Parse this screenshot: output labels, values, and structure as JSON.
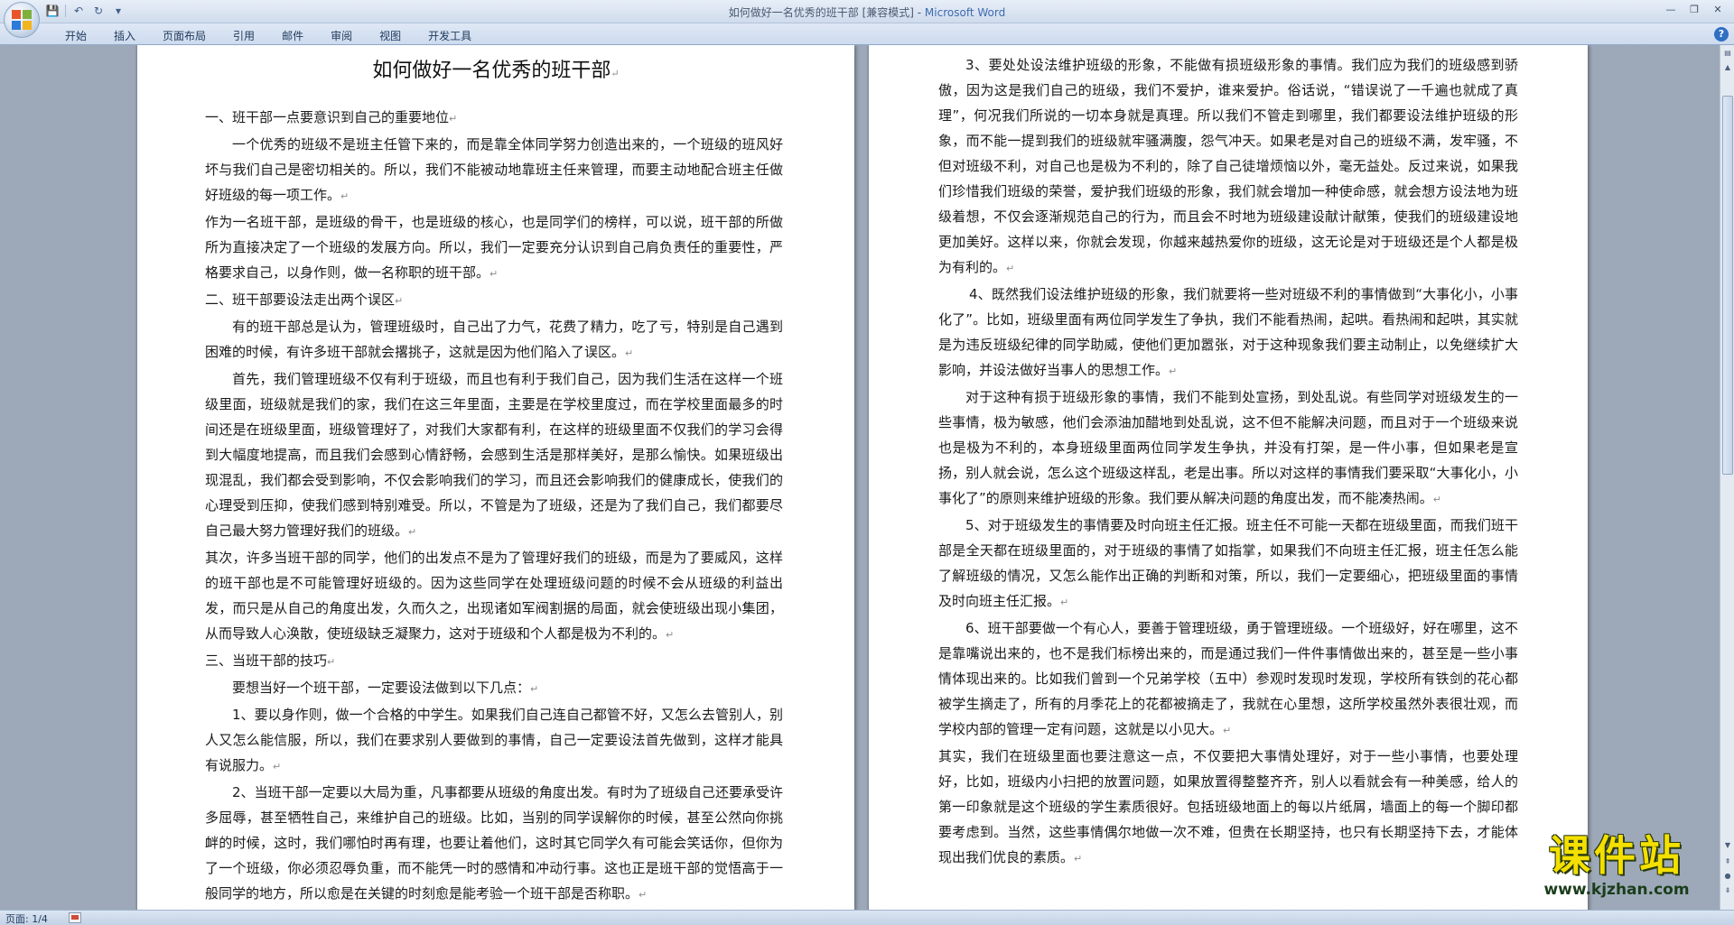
{
  "window": {
    "title_doc": "如何做好一名优秀的班干部 [兼容模式] - ",
    "title_app": "Microsoft Word",
    "minimize": "—",
    "restore": "❐",
    "close": "✕"
  },
  "qat": {
    "save": "💾",
    "undo": "↶",
    "redo": "↻",
    "customize": "▾"
  },
  "ribbon": {
    "tabs": [
      "开始",
      "插入",
      "页面布局",
      "引用",
      "邮件",
      "审阅",
      "视图",
      "开发工具"
    ],
    "help": "?"
  },
  "page1": {
    "title": "如何做好一名优秀的班干部",
    "paragraphs": [
      "一、班干部一点要意识到自己的重要地位",
      "一个优秀的班级不是班主任管下来的，而是靠全体同学努力创造出来的，一个班级的班风好坏与我们自己是密切相关的。所以，我们不能被动地靠班主任来管理，而要主动地配合班主任做好班级的每一项工作。",
      "作为一名班干部，是班级的骨干，也是班级的核心，也是同学们的榜样，可以说，班干部的所做所为直接决定了一个班级的发展方向。所以，我们一定要充分认识到自己肩负责任的重要性，严格要求自己，以身作则，做一名称职的班干部。",
      "二、班干部要设法走出两个误区",
      "有的班干部总是认为，管理班级时，自己出了力气，花费了精力，吃了亏，特别是自己遇到困难的时候，有许多班干部就会撂挑子，这就是因为他们陷入了误区。",
      "首先，我们管理班级不仅有利于班级，而且也有利于我们自己，因为我们生活在这样一个班级里面，班级就是我们的家，我们在这三年里面，主要是在学校里度过，而在学校里面最多的时间还是在班级里面，班级管理好了，对我们大家都有利，在这样的班级里面不仅我们的学习会得到大幅度地提高，而且我们会感到心情舒畅，会感到生活是那样美好，是那么愉快。如果班级出现混乱，我们都会受到影响，不仅会影响我们的学习，而且还会影响我们的健康成长，使我们的心理受到压抑，使我们感到特别难受。所以，不管是为了班级，还是为了我们自己，我们都要尽自己最大努力管理好我们的班级。",
      "其次，许多当班干部的同学，他们的出发点不是为了管理好我们的班级，而是为了要威风，这样的班干部也是不可能管理好班级的。因为这些同学在处理班级问题的时候不会从班级的利益出发，而只是从自己的角度出发，久而久之，出现诸如军阀割据的局面，就会使班级出现小集团，从而导致人心涣散，使班级缺乏凝聚力，这对于班级和个人都是极为不利的。",
      "三、当班干部的技巧",
      "要想当好一个班干部，一定要设法做到以下几点：",
      "1、要以身作则，做一个合格的中学生。如果我们自己连自己都管不好，又怎么去管别人，别人又怎么能信服，所以，我们在要求别人要做到的事情，自己一定要设法首先做到，这样才能具有说服力。",
      "2、当班干部一定要以大局为重，凡事都要从班级的角度出发。有时为了班级自己还要承受许多屈辱，甚至牺牲自己，来维护自己的班级。比如，当别的同学误解你的时候，甚至公然向你挑衅的时候，这时，我们哪怕时再有理，也要让着他们，这时其它同学久有可能会笑话你，但你为了一个班级，你必须忍辱负重，而不能凭一时的感情和冲动行事。这也正是班干部的觉悟高于一般同学的地方，所以愈是在关键的时刻愈是能考验一个班干部是否称职。"
    ]
  },
  "page2": {
    "paragraphs": [
      "3、要处处设法维护班级的形象，不能做有损班级形象的事情。我们应为我们的班级感到骄傲，因为这是我们自己的班级，我们不爱护，谁来爱护。俗话说，“错误说了一千遍也就成了真理”，何况我们所说的一切本身就是真理。所以我们不管走到哪里，我们都要设法维护班级的形象，而不能一提到我们的班级就牢骚满腹，怨气冲天。如果老是对自己的班级不满，发牢骚，不但对班级不利，对自己也是极为不利的，除了自己徒增烦恼以外，毫无益处。反过来说，如果我们珍惜我们班级的荣誉，爱护我们班级的形象，我们就会增加一种使命感，就会想方设法地为班级着想，不仅会逐渐规范自己的行为，而且会不时地为班级建设献计献策，使我们的班级建设地更加美好。这样以来，你就会发现，你越来越热爱你的班级，这无论是对于班级还是个人都是极为有利的。",
      "4、既然我们设法维护班级的形象，我们就要将一些对班级不利的事情做到“大事化小，小事化了”。比如，班级里面有两位同学发生了争执，我们不能看热闹，起哄。看热闹和起哄，其实就是为违反班级纪律的同学助威，使他们更加嚣张，对于这种现象我们要主动制止，以免继续扩大影响，并设法做好当事人的思想工作。",
      "对于这种有损于班级形象的事情，我们不能到处宣扬，到处乱说。有些同学对班级发生的一些事情，极为敏感，他们会添油加醋地到处乱说，这不但不能解决问题，而且对于一个班级来说也是极为不利的，本身班级里面两位同学发生争执，并没有打架，是一件小事，但如果老是宣扬，别人就会说，怎么这个班级这样乱，老是出事。所以对这样的事情我们要采取“大事化小，小事化了”的原则来维护班级的形象。我们要从解决问题的角度出发，而不能凑热闹。",
      "5、对于班级发生的事情要及时向班主任汇报。班主任不可能一天都在班级里面，而我们班干部是全天都在班级里面的，对于班级的事情了如指掌，如果我们不向班主任汇报，班主任怎么能了解班级的情况，又怎么能作出正确的判断和对策，所以，我们一定要细心，把班级里面的事情及时向班主任汇报。",
      "6、班干部要做一个有心人，要善于管理班级，勇于管理班级。一个班级好，好在哪里，这不是靠嘴说出来的，也不是我们标榜出来的，而是通过我们一件件事情做出来的，甚至是一些小事情体现出来的。比如我们曾到一个兄弟学校（五中）参观时发现时发现，学校所有铁剑的花心都被学生摘走了，所有的月季花上的花都被摘走了，我就在心里想，这所学校虽然外表很壮观，而学校内部的管理一定有问题，这就是以小见大。",
      "其实，我们在班级里面也要注意这一点，不仅要把大事情处理好，对于一些小事情，也要处理好，比如，班级内小扫把的放置问题，如果放置得整整齐齐，别人以看就会有一种美感，给人的第一印象就是这个班级的学生素质很好。包括班级地面上的每以片纸屑，墙面上的每一个脚印都要考虑到。当然，这些事情偶尔地做一次不难，但贵在长期坚持，也只有长期坚持下去，才能体现出我们优良的素质。"
    ]
  },
  "paragraph_mark": "↵",
  "status": {
    "page": "页面: 1/4"
  },
  "watermark": {
    "main": "课件站",
    "sub": "www.kjzhan.com"
  }
}
